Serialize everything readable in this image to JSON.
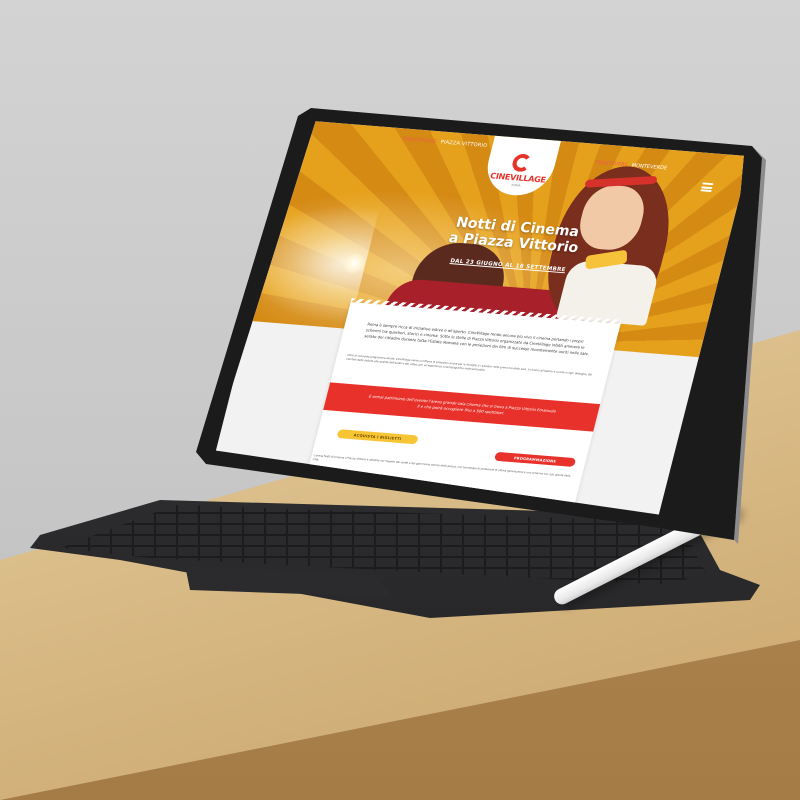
{
  "website": {
    "nav": {
      "left_prefix": "TRASTEVERE",
      "left_label": "PIAZZA VITTORIO",
      "right_prefix": "TRASTEVERE",
      "right_label": "MONTEVERDE"
    },
    "logo": {
      "brand": "CINEVILLAGE",
      "sub": "ROMA"
    },
    "hero": {
      "title_line1": "Notti di Cinema",
      "title_line2": "a Piazza Vittorio",
      "dates": "DAL 23 GIUGNO AL 16 SETTEMBRE"
    },
    "content": {
      "intro": "Roma è sempre ricca di iniziative estive e all'aperto. CineVillage rende ancora più vivo il cinema portando i propri schermi tra quartieri, storici e cinema. Sotto le stelle di Piazza Vittorio organizzato da CineVillage infatti animerà le serate dei cittadini durante tutta l'Estate Romana con le proiezioni dei film di successo recentemente usciti nelle sale.",
      "detail": "Oltre al consueto programma serale, CineVillage vanta un'offerta di proiezioni anche per le famiglie e i bambini nelle prime ore della sera. Il cinema all'aperto è curato in ogni dettaglio, dal comfort delle sedute alla qualità dell'audio e del video, per un'esperienza cinematografica indimenticabile.",
      "banner": "È ormai patrimonio dell'evento l'arena grande sala cinema che si trova a Piazza Vittorio Emanuele II e che potrà accogliere fino a 500 spettatori.",
      "buy_button": "ACQUISTA I BIGLIETTI",
      "program_button": "PROGRAMMAZIONE",
      "footer_text": "L'arena Notti di Cinema a Piazza Vittorio è allestita nel rispetto del verde e del patrimonio storico della piazza, con tecnologie di proiezione di ultima generazione e uno schermo tra i più grandi della città."
    }
  },
  "colors": {
    "accent_red": "#e8312b",
    "accent_yellow": "#f7c534",
    "hero_orange": "#e6a11c"
  }
}
